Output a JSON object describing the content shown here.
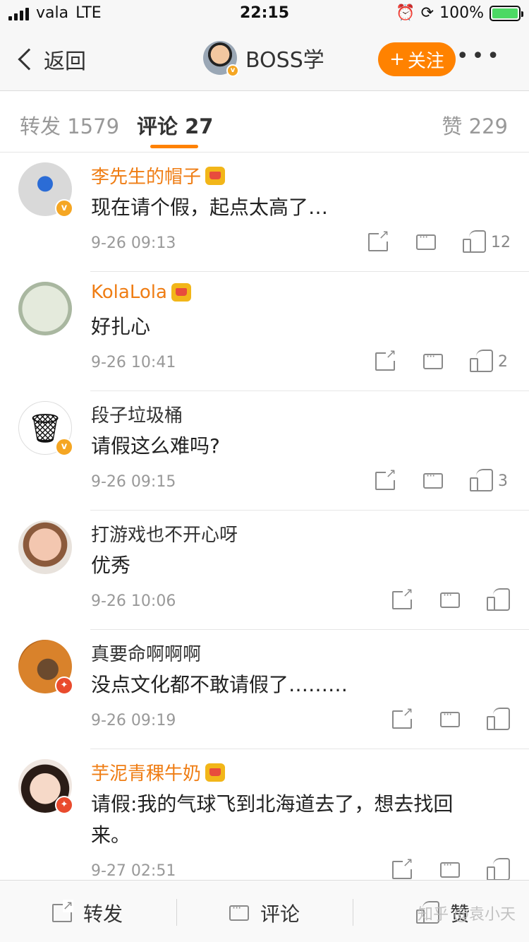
{
  "status_bar": {
    "carrier": "vala",
    "network": "LTE",
    "time": "22:15",
    "battery": "100%"
  },
  "nav": {
    "back_label": "返回",
    "title": "BOSS学",
    "follow_label": "关注",
    "follow_plus": "+",
    "more_label": "•••"
  },
  "tabs": {
    "repost": "转发 1579",
    "comment": "评论 27",
    "like": "赞 229"
  },
  "comments": [
    {
      "name": "李先生的帽子",
      "vip": true,
      "badge": "v",
      "text": "现在请个假，起点太高了…",
      "time": "9-26 09:13",
      "likes": "12"
    },
    {
      "name": "KolaLola",
      "vip": true,
      "badge": "",
      "text": "好扎心",
      "time": "9-26 10:41",
      "likes": "2"
    },
    {
      "name": "段子垃圾桶",
      "vip": false,
      "badge": "v",
      "text": "请假这么难吗?",
      "time": "9-26 09:15",
      "likes": "3"
    },
    {
      "name": "打游戏也不开心呀",
      "vip": false,
      "badge": "",
      "text": "优秀",
      "time": "9-26 10:06",
      "likes": ""
    },
    {
      "name": "真要命啊啊啊",
      "vip": false,
      "badge": "r",
      "text": "没点文化都不敢请假了………",
      "time": "9-26 09:19",
      "likes": ""
    },
    {
      "name": "芋泥青稞牛奶",
      "vip": true,
      "badge": "r",
      "text": "请假:我的气球飞到北海道去了，想去找回来。",
      "time": "9-27 02:51",
      "likes": ""
    }
  ],
  "bottom_bar": {
    "repost": "转发",
    "comment": "评论",
    "like": "赞"
  },
  "watermark": "知乎 @袁小天",
  "colors": {
    "accent": "#ff8200",
    "vip_name": "#ef7d14",
    "verified_badge": "#f5a623",
    "red_badge": "#e94b2d"
  }
}
